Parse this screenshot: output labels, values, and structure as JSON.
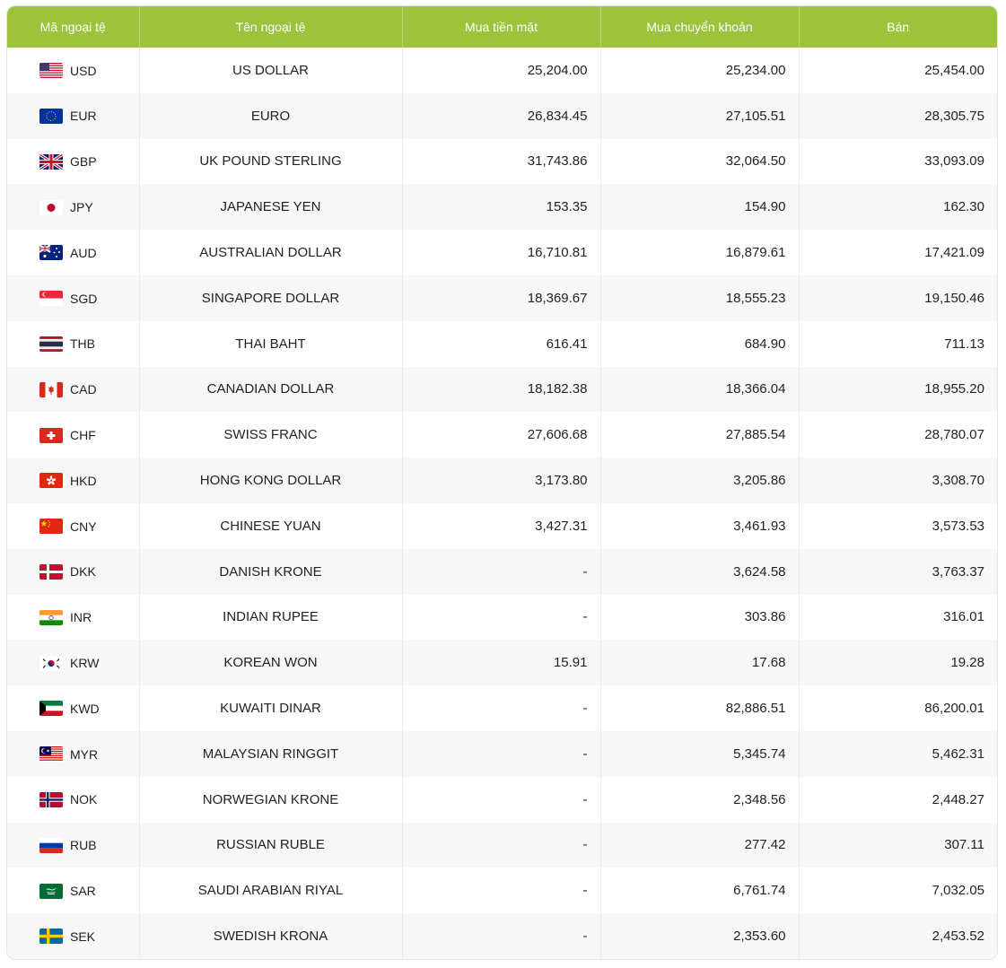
{
  "header": {
    "code": "Mã ngoại tệ",
    "name": "Tên ngoại tệ",
    "cash_buy": "Mua tiền mặt",
    "transfer_buy": "Mua chuyển khoản",
    "sell": "Bán"
  },
  "colors": {
    "header_bg": "#9dc23c",
    "header_text": "#ffffff",
    "stripe": "#f7f7f7"
  },
  "rows": [
    {
      "code": "USD",
      "name": "US DOLLAR",
      "cash": "25,204.00",
      "transfer": "25,234.00",
      "sell": "25,454.00",
      "flag_icon": "us-flag-icon"
    },
    {
      "code": "EUR",
      "name": "EURO",
      "cash": "26,834.45",
      "transfer": "27,105.51",
      "sell": "28,305.75",
      "flag_icon": "eu-flag-icon"
    },
    {
      "code": "GBP",
      "name": "UK POUND STERLING",
      "cash": "31,743.86",
      "transfer": "32,064.50",
      "sell": "33,093.09",
      "flag_icon": "uk-flag-icon"
    },
    {
      "code": "JPY",
      "name": "JAPANESE YEN",
      "cash": "153.35",
      "transfer": "154.90",
      "sell": "162.30",
      "flag_icon": "jp-flag-icon"
    },
    {
      "code": "AUD",
      "name": "AUSTRALIAN DOLLAR",
      "cash": "16,710.81",
      "transfer": "16,879.61",
      "sell": "17,421.09",
      "flag_icon": "au-flag-icon"
    },
    {
      "code": "SGD",
      "name": "SINGAPORE DOLLAR",
      "cash": "18,369.67",
      "transfer": "18,555.23",
      "sell": "19,150.46",
      "flag_icon": "sg-flag-icon"
    },
    {
      "code": "THB",
      "name": "THAI BAHT",
      "cash": "616.41",
      "transfer": "684.90",
      "sell": "711.13",
      "flag_icon": "th-flag-icon"
    },
    {
      "code": "CAD",
      "name": "CANADIAN DOLLAR",
      "cash": "18,182.38",
      "transfer": "18,366.04",
      "sell": "18,955.20",
      "flag_icon": "ca-flag-icon"
    },
    {
      "code": "CHF",
      "name": "SWISS FRANC",
      "cash": "27,606.68",
      "transfer": "27,885.54",
      "sell": "28,780.07",
      "flag_icon": "ch-flag-icon"
    },
    {
      "code": "HKD",
      "name": "HONG KONG DOLLAR",
      "cash": "3,173.80",
      "transfer": "3,205.86",
      "sell": "3,308.70",
      "flag_icon": "hk-flag-icon"
    },
    {
      "code": "CNY",
      "name": "CHINESE YUAN",
      "cash": "3,427.31",
      "transfer": "3,461.93",
      "sell": "3,573.53",
      "flag_icon": "cn-flag-icon"
    },
    {
      "code": "DKK",
      "name": "DANISH KRONE",
      "cash": "-",
      "transfer": "3,624.58",
      "sell": "3,763.37",
      "flag_icon": "dk-flag-icon"
    },
    {
      "code": "INR",
      "name": "INDIAN RUPEE",
      "cash": "-",
      "transfer": "303.86",
      "sell": "316.01",
      "flag_icon": "in-flag-icon"
    },
    {
      "code": "KRW",
      "name": "KOREAN WON",
      "cash": "15.91",
      "transfer": "17.68",
      "sell": "19.28",
      "flag_icon": "kr-flag-icon"
    },
    {
      "code": "KWD",
      "name": "KUWAITI DINAR",
      "cash": "-",
      "transfer": "82,886.51",
      "sell": "86,200.01",
      "flag_icon": "kw-flag-icon"
    },
    {
      "code": "MYR",
      "name": "MALAYSIAN RINGGIT",
      "cash": "-",
      "transfer": "5,345.74",
      "sell": "5,462.31",
      "flag_icon": "my-flag-icon"
    },
    {
      "code": "NOK",
      "name": "NORWEGIAN KRONE",
      "cash": "-",
      "transfer": "2,348.56",
      "sell": "2,448.27",
      "flag_icon": "no-flag-icon"
    },
    {
      "code": "RUB",
      "name": "RUSSIAN RUBLE",
      "cash": "-",
      "transfer": "277.42",
      "sell": "307.11",
      "flag_icon": "ru-flag-icon"
    },
    {
      "code": "SAR",
      "name": "SAUDI ARABIAN RIYAL",
      "cash": "-",
      "transfer": "6,761.74",
      "sell": "7,032.05",
      "flag_icon": "sa-flag-icon"
    },
    {
      "code": "SEK",
      "name": "SWEDISH KRONA",
      "cash": "-",
      "transfer": "2,353.60",
      "sell": "2,453.52",
      "flag_icon": "se-flag-icon"
    }
  ]
}
